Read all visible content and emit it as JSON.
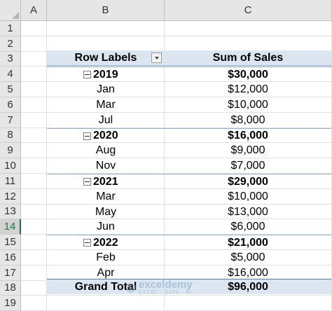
{
  "columns": [
    "A",
    "B",
    "C"
  ],
  "rows": [
    "1",
    "2",
    "3",
    "4",
    "5",
    "6",
    "7",
    "8",
    "9",
    "10",
    "11",
    "12",
    "13",
    "14",
    "15",
    "16",
    "17",
    "18",
    "19"
  ],
  "active_row": "14",
  "pivot": {
    "header": {
      "row_labels": "Row Labels",
      "sum_label": "Sum of Sales"
    },
    "groups": [
      {
        "year": "2019",
        "total": "$30,000",
        "items": [
          {
            "month": "Jan",
            "sales": "$12,000"
          },
          {
            "month": "Mar",
            "sales": "$10,000"
          },
          {
            "month": "Jul",
            "sales": "$8,000"
          }
        ]
      },
      {
        "year": "2020",
        "total": "$16,000",
        "items": [
          {
            "month": "Aug",
            "sales": "$9,000"
          },
          {
            "month": "Nov",
            "sales": "$7,000"
          }
        ]
      },
      {
        "year": "2021",
        "total": "$29,000",
        "items": [
          {
            "month": "Mar",
            "sales": "$10,000"
          },
          {
            "month": "May",
            "sales": "$13,000"
          },
          {
            "month": "Jun",
            "sales": "$6,000"
          }
        ]
      },
      {
        "year": "2022",
        "total": "$21,000",
        "items": [
          {
            "month": "Feb",
            "sales": "$5,000"
          },
          {
            "month": "Apr",
            "sales": "$16,000"
          }
        ]
      }
    ],
    "grand_total": {
      "label": "Grand Total",
      "value": "$96,000"
    }
  },
  "watermark": {
    "name": "exceldemy",
    "tagline": "EXCEL · DATA · BI"
  },
  "colors": {
    "pivot_header": "#dce6f1",
    "pivot_border": "#95b3d7",
    "active_row": "#217346"
  }
}
